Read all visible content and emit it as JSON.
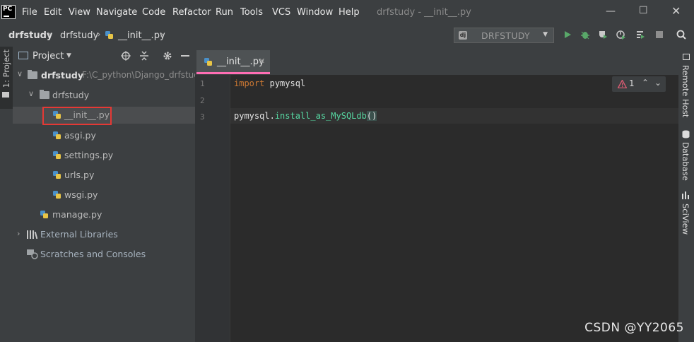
{
  "menubar": {
    "logo": "PC",
    "items": [
      "File",
      "Edit",
      "View",
      "Navigate",
      "Code",
      "Refactor",
      "Run",
      "Tools",
      "VCS",
      "Window",
      "Help"
    ],
    "title": "drfstudy - __init__.py",
    "icons": [
      "minimize-icon",
      "maximize-icon",
      "close-icon"
    ]
  },
  "navbar": {
    "breadcrumbs": [
      "drfstudy",
      "drfstudy",
      "__init__.py"
    ],
    "run_config": "DRFSTUDY",
    "run_config_icon": "dj",
    "toolbar_icons": [
      "run-icon",
      "debug-icon",
      "coverage-icon",
      "profile-icon",
      "build-icon",
      "stop-icon",
      "search-icon"
    ]
  },
  "left_stripe": {
    "project_tab": "1: Project"
  },
  "project_panel": {
    "title": "Project",
    "root": {
      "name": "drfstudy",
      "path": "F:\\C_python\\Django_drfstud"
    },
    "package": "drfstudy",
    "files": [
      "__init__.py",
      "asgi.py",
      "settings.py",
      "urls.py",
      "wsgi.py"
    ],
    "manage": "manage.py",
    "external_libraries": "External Libraries",
    "scratches": "Scratches and Consoles"
  },
  "editor": {
    "tab_label": "__init__.py",
    "line_numbers": [
      "1",
      "2",
      "3"
    ],
    "line1": {
      "keyword": "import",
      "module": "pymysql"
    },
    "line3": {
      "object": "pymysql",
      "dot": ".",
      "method": "install_as_MySQLdb",
      "call": "()"
    },
    "inspection_count": "1"
  },
  "right_stripe": [
    "Remote Host",
    "Database",
    "SciView"
  ],
  "watermark": "CSDN @YY2065",
  "colors": {
    "accent_tab": "#ff6eb4",
    "selection_box": "#e53935",
    "keyword": "#cc7832",
    "method": "#57d9a3",
    "run_green": "#59a869"
  }
}
